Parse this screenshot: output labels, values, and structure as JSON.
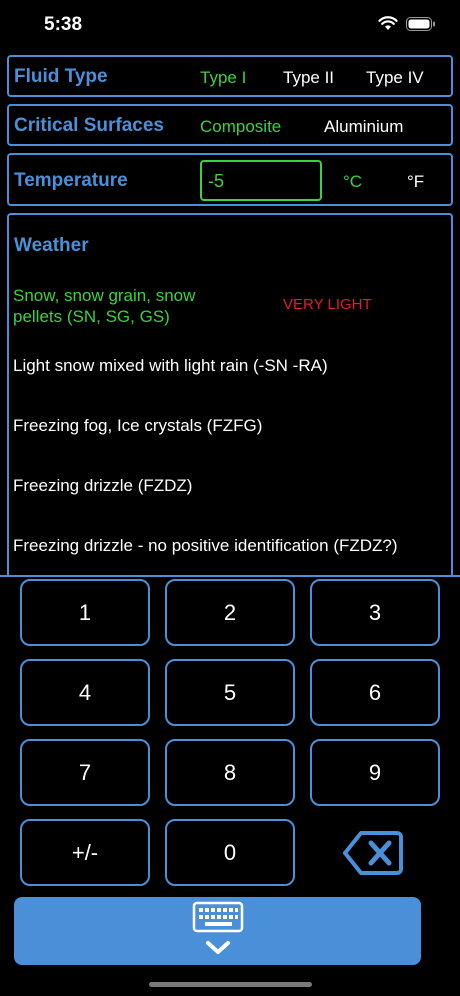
{
  "status": {
    "time": "5:38"
  },
  "fluid_type": {
    "title": "Fluid Type",
    "options": [
      "Type I",
      "Type II",
      "Type IV"
    ],
    "selected": "Type I"
  },
  "critical_surfaces": {
    "title": "Critical Surfaces",
    "options": [
      "Composite",
      "Aluminium"
    ],
    "selected": "Composite"
  },
  "temperature": {
    "title": "Temperature",
    "value": "-5",
    "units": [
      "°C",
      "°F"
    ],
    "selected_unit": "°C"
  },
  "weather": {
    "title": "Weather",
    "items": [
      "Snow, snow grain, snow pellets (SN, SG, GS)",
      "Light snow mixed with light rain (-SN -RA)",
      "Freezing fog, Ice crystals (FZFG)",
      "Freezing drizzle (FZDZ)",
      "Freezing drizzle - no positive identification (FZDZ?)"
    ],
    "selected_index": 0,
    "selected_intensity": "VERY LIGHT"
  },
  "keypad": {
    "keys": [
      "1",
      "2",
      "3",
      "4",
      "5",
      "6",
      "7",
      "8",
      "9",
      "+/-",
      "0"
    ]
  },
  "colors": {
    "accent": "#4a90d9",
    "selected": "#3dd23d",
    "intensity": "#e8192c",
    "background": "#000000"
  },
  "icons": {
    "backspace": "delete-backward-icon",
    "dismiss": "keyboard-dismiss-icon"
  }
}
